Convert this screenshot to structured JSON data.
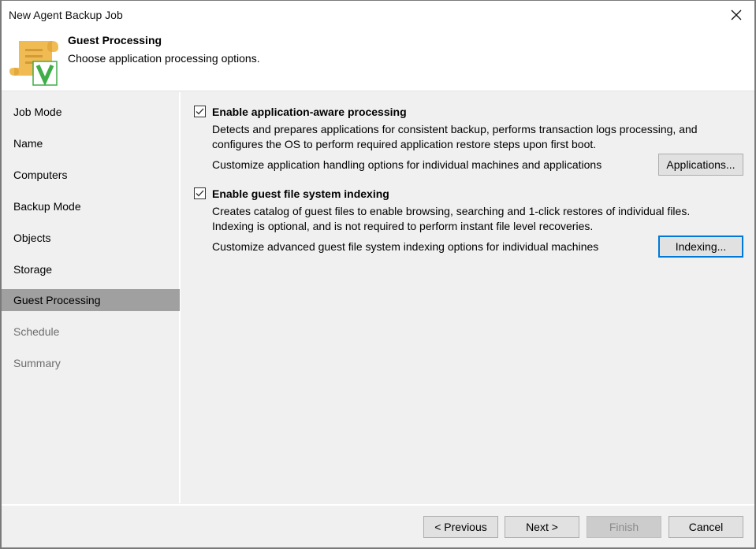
{
  "window": {
    "title": "New Agent Backup Job",
    "close_icon": "close-icon"
  },
  "header": {
    "icon": "scroll-with-checkmark-icon",
    "icon_badge_letter": "V",
    "title": "Guest Processing",
    "description": "Choose application processing options."
  },
  "sidebar": {
    "items": [
      {
        "label": "Job Mode",
        "state": "normal"
      },
      {
        "label": "Name",
        "state": "normal"
      },
      {
        "label": "Computers",
        "state": "normal"
      },
      {
        "label": "Backup Mode",
        "state": "normal"
      },
      {
        "label": "Objects",
        "state": "normal"
      },
      {
        "label": "Storage",
        "state": "normal"
      },
      {
        "label": "Guest Processing",
        "state": "active"
      },
      {
        "label": "Schedule",
        "state": "disabled"
      },
      {
        "label": "Summary",
        "state": "disabled"
      }
    ]
  },
  "content": {
    "app_aware": {
      "checked": true,
      "label": "Enable application-aware processing",
      "desc_line1": "Detects and prepares applications for consistent backup, performs transaction logs processing, and",
      "desc_line2": "configures the OS to perform required application restore steps upon first boot.",
      "customize_text": "Customize application handling options for individual machines and applications",
      "button_label": "Applications..."
    },
    "indexing": {
      "checked": true,
      "label": "Enable guest file system indexing",
      "desc_line1": "Creates catalog of guest files to enable browsing, searching and 1-click restores of individual files.",
      "desc_line2": "Indexing is optional, and is not required to perform instant file level recoveries.",
      "customize_text": "Customize advanced guest file system indexing options for individual machines",
      "button_label": "Indexing..."
    }
  },
  "footer": {
    "previous_label": "< Previous",
    "next_label": "Next >",
    "finish_label": "Finish",
    "cancel_label": "Cancel"
  },
  "colors": {
    "focus_accent": "#0078d7",
    "active_nav_bg": "#a0a0a0",
    "logo_scroll": "#f0bb52",
    "logo_check": "#3fae49"
  }
}
